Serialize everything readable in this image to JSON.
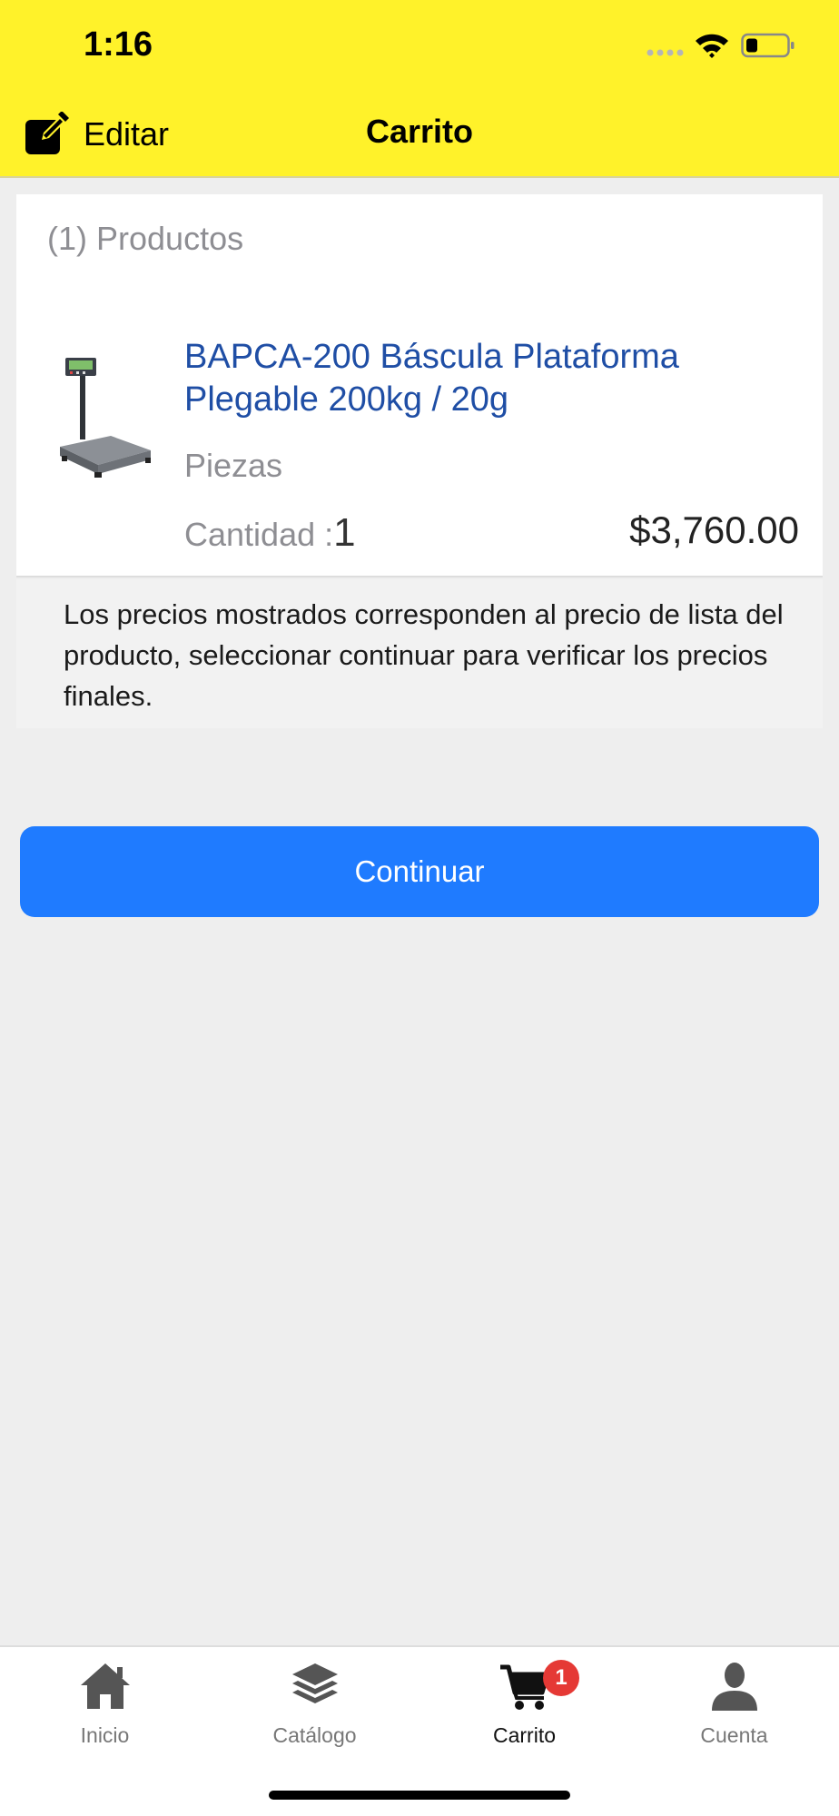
{
  "status_bar": {
    "time": "1:16"
  },
  "nav": {
    "edit_label": "Editar",
    "title": "Carrito"
  },
  "cart": {
    "products_count": "(1) Productos",
    "item": {
      "name": "BAPCA-200 Báscula Plataforma Plegable 200kg / 20g",
      "unit": "Piezas",
      "quantity_label": "Cantidad :",
      "quantity": "1",
      "price": "$3,760.00"
    }
  },
  "notice": "Los precios mostrados corresponden al precio de lista del producto, seleccionar continuar para verificar los precios finales.",
  "continue_label": "Continuar",
  "tabbar": {
    "tabs": [
      {
        "label": "Inicio",
        "icon": "home-icon"
      },
      {
        "label": "Catálogo",
        "icon": "layers-icon"
      },
      {
        "label": "Carrito",
        "icon": "cart-icon",
        "badge": "1",
        "active": true
      },
      {
        "label": "Cuenta",
        "icon": "user-icon"
      }
    ]
  },
  "colors": {
    "header_bg": "#fff22a",
    "primary_button": "#1f7bff",
    "product_link": "#1f4ea5",
    "badge": "#e53935"
  }
}
